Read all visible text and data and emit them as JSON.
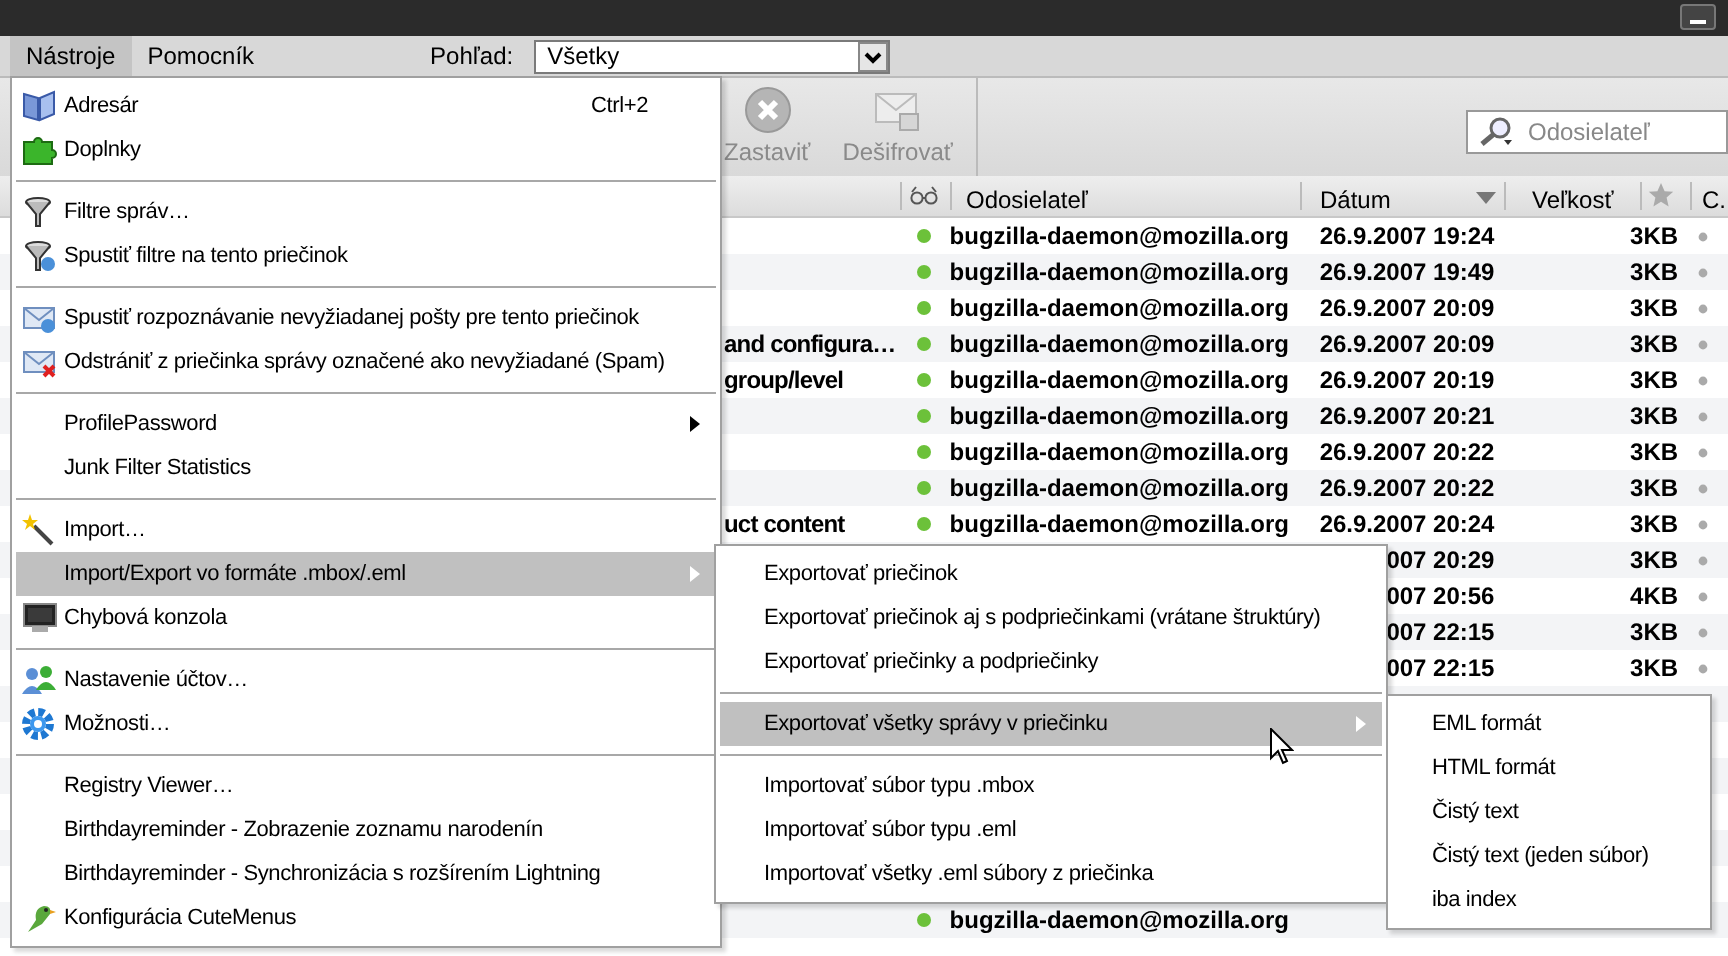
{
  "menubar": {
    "items": [
      {
        "label": "Nástroje",
        "selected": true
      },
      {
        "label": "Pomocník",
        "selected": false
      }
    ],
    "view_label": "Pohľad:",
    "view_value": "Všetky"
  },
  "toolbar": {
    "buttons": [
      {
        "label": "Zastaviť",
        "disabled": true
      },
      {
        "label": "Dešifrovať",
        "disabled": true
      }
    ],
    "search": {
      "placeholder": "Odosielateľ"
    }
  },
  "table": {
    "columns": [
      "Odosielateľ",
      "Dátum",
      "Veľkosť",
      "C."
    ],
    "rows": [
      {
        "subject": "",
        "sender": "bugzilla-daemon@mozilla.org",
        "date": "26.9.2007 19:24",
        "size": "3KB",
        "unread": true
      },
      {
        "subject": "",
        "sender": "bugzilla-daemon@mozilla.org",
        "date": "26.9.2007 19:49",
        "size": "3KB",
        "unread": true
      },
      {
        "subject": "",
        "sender": "bugzilla-daemon@mozilla.org",
        "date": "26.9.2007 20:09",
        "size": "3KB",
        "unread": true
      },
      {
        "subject": "and configura…",
        "sender": "bugzilla-daemon@mozilla.org",
        "date": "26.9.2007 20:09",
        "size": "3KB",
        "unread": true
      },
      {
        "subject": "group/level",
        "sender": "bugzilla-daemon@mozilla.org",
        "date": "26.9.2007 20:19",
        "size": "3KB",
        "unread": true
      },
      {
        "subject": "",
        "sender": "bugzilla-daemon@mozilla.org",
        "date": "26.9.2007 20:21",
        "size": "3KB",
        "unread": true
      },
      {
        "subject": "",
        "sender": "bugzilla-daemon@mozilla.org",
        "date": "26.9.2007 20:22",
        "size": "3KB",
        "unread": true
      },
      {
        "subject": "",
        "sender": "bugzilla-daemon@mozilla.org",
        "date": "26.9.2007 20:22",
        "size": "3KB",
        "unread": true
      },
      {
        "subject": "uct content",
        "sender": "bugzilla-daemon@mozilla.org",
        "date": "26.9.2007 20:24",
        "size": "3KB",
        "unread": true
      },
      {
        "subject": "",
        "sender": "",
        "date": "007 20:29",
        "size": "3KB",
        "unread": true
      },
      {
        "subject": "",
        "sender": "",
        "date": "007 20:56",
        "size": "4KB",
        "unread": true
      },
      {
        "subject": "",
        "sender": "",
        "date": "007 22:15",
        "size": "3KB",
        "unread": true
      },
      {
        "subject": "",
        "sender": "",
        "date": "007 22:15",
        "size": "3KB",
        "unread": true
      },
      {
        "subject": "",
        "sender": "bugzilla-daemon@mozilla.org",
        "date": "",
        "size": "",
        "unread": true
      }
    ]
  },
  "menus": [
    {
      "items": [
        {
          "kind": "item",
          "label": "Adresár",
          "shortcut": "Ctrl+2",
          "submenu": false,
          "selected": false
        },
        {
          "kind": "item",
          "label": "Doplnky",
          "submenu": false,
          "selected": false
        },
        {
          "kind": "separator"
        },
        {
          "kind": "item",
          "label": "Filtre správ…",
          "submenu": false,
          "selected": false
        },
        {
          "kind": "item",
          "label": "Spustiť filtre na tento priečinok",
          "submenu": false,
          "selected": false
        },
        {
          "kind": "separator"
        },
        {
          "kind": "item",
          "label": "Spustiť rozpoznávanie nevyžiadanej pošty pre tento priečinok",
          "submenu": false,
          "selected": false
        },
        {
          "kind": "item",
          "label": "Odstrániť z priečinka správy označené ako nevyžiadané (Spam)",
          "submenu": false,
          "selected": false
        },
        {
          "kind": "separator"
        },
        {
          "kind": "item",
          "label": "ProfilePassword",
          "submenu": true,
          "selected": false
        },
        {
          "kind": "item",
          "label": "Junk Filter Statistics",
          "submenu": false,
          "selected": false
        },
        {
          "kind": "separator"
        },
        {
          "kind": "item",
          "label": "Import…",
          "submenu": false,
          "selected": false
        },
        {
          "kind": "item",
          "label": "Import/Export vo formáte .mbox/.eml",
          "submenu": true,
          "selected": true
        },
        {
          "kind": "item",
          "label": "Chybová konzola",
          "submenu": false,
          "selected": false
        },
        {
          "kind": "separator"
        },
        {
          "kind": "item",
          "label": "Nastavenie účtov…",
          "submenu": false,
          "selected": false
        },
        {
          "kind": "item",
          "label": "Možnosti…",
          "submenu": false,
          "selected": false
        },
        {
          "kind": "separator"
        },
        {
          "kind": "item",
          "label": "Registry Viewer…",
          "submenu": false,
          "selected": false
        },
        {
          "kind": "item",
          "label": "Birthdayreminder - Zobrazenie zoznamu narodenín",
          "submenu": false,
          "selected": false
        },
        {
          "kind": "item",
          "label": "Birthdayreminder - Synchronizácia s rozšírením Lightning",
          "submenu": false,
          "selected": false
        },
        {
          "kind": "item",
          "label": "Konfigurácia CuteMenus",
          "submenu": false,
          "selected": false
        }
      ]
    },
    {
      "items": [
        {
          "kind": "item",
          "label": "Exportovať priečinok",
          "submenu": false,
          "selected": false
        },
        {
          "kind": "item",
          "label": "Exportovať priečinok aj s podpriečinkami (vrátane štruktúry)",
          "submenu": false,
          "selected": false
        },
        {
          "kind": "item",
          "label": "Exportovať priečinky a podpriečinky",
          "submenu": false,
          "selected": false
        },
        {
          "kind": "separator"
        },
        {
          "kind": "item",
          "label": "Exportovať všetky správy v priečinku",
          "submenu": true,
          "selected": true
        },
        {
          "kind": "separator"
        },
        {
          "kind": "item",
          "label": "Importovať súbor typu .mbox",
          "submenu": false,
          "selected": false
        },
        {
          "kind": "item",
          "label": "Importovať súbor typu .eml",
          "submenu": false,
          "selected": false
        },
        {
          "kind": "item",
          "label": "Importovať všetky .eml súbory z priečinka",
          "submenu": false,
          "selected": false
        }
      ]
    },
    {
      "items": [
        {
          "kind": "item",
          "label": "EML formát",
          "submenu": false,
          "selected": false
        },
        {
          "kind": "item",
          "label": "HTML formát",
          "submenu": false,
          "selected": false
        },
        {
          "kind": "item",
          "label": "Čistý text",
          "submenu": false,
          "selected": false
        },
        {
          "kind": "item",
          "label": "Čistý text (jeden súbor)",
          "submenu": false,
          "selected": false
        },
        {
          "kind": "item",
          "label": "iba index",
          "submenu": false,
          "selected": false
        }
      ]
    }
  ]
}
